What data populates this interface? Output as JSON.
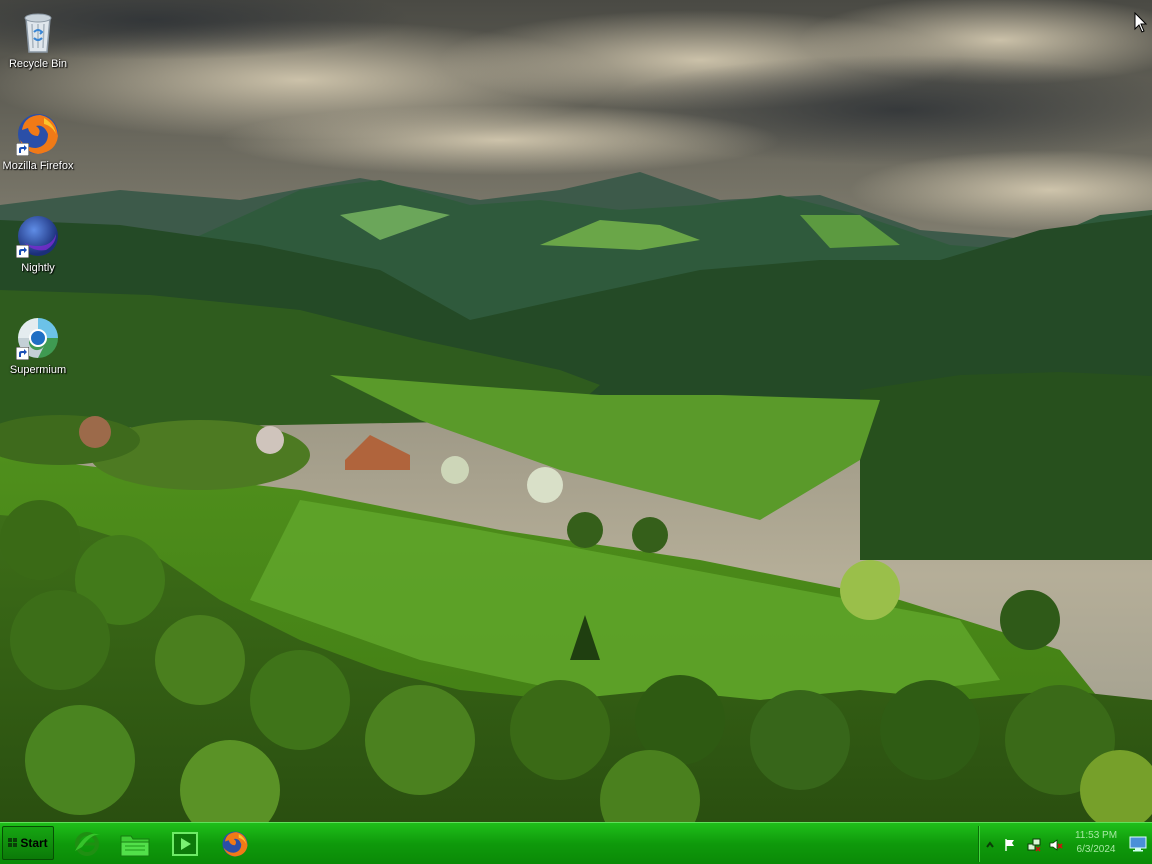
{
  "desktop": {
    "icons": [
      {
        "label": "Recycle Bin",
        "icon": "recycle-bin-icon"
      },
      {
        "label": "Mozilla Firefox",
        "icon": "firefox-icon"
      },
      {
        "label": "Nightly",
        "icon": "nightly-icon"
      },
      {
        "label": "Supermium",
        "icon": "supermium-icon"
      }
    ]
  },
  "taskbar": {
    "start_label": "Start",
    "quick_launch": [
      {
        "icon": "internet-explorer-icon"
      },
      {
        "icon": "file-explorer-icon"
      },
      {
        "icon": "media-player-icon"
      },
      {
        "icon": "firefox-icon"
      }
    ],
    "tray": {
      "icons": [
        "show-hidden-icons-icon",
        "action-center-flag-icon",
        "network-icon",
        "volume-muted-icon"
      ],
      "time": "11:53 PM",
      "date": "6/3/2024"
    }
  },
  "colors": {
    "taskbar": "#109f0c",
    "taskbar_highlight": "#5fe05a",
    "clock_text": "#a6e8a3"
  }
}
